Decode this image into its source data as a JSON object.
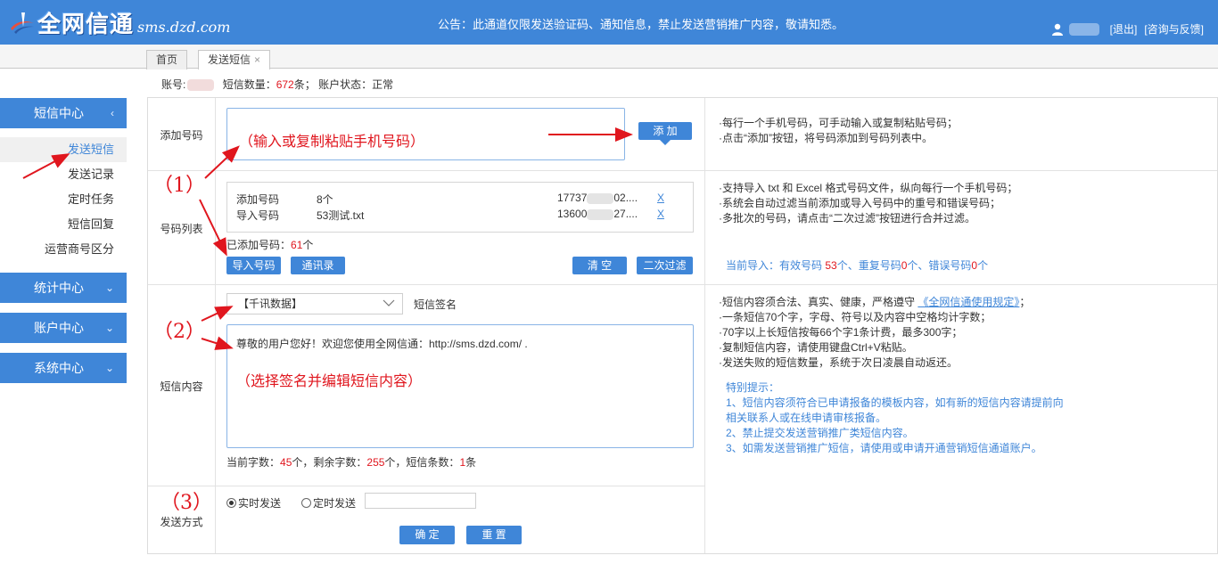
{
  "header": {
    "brand": "全网信通",
    "domain": "sms.dzd.com",
    "notice": "公告：此通道仅限发送验证码、通知信息，禁止发送营销推广内容，敬请知悉。",
    "logout": "[退出]",
    "feedback": "[咨询与反馈]"
  },
  "tabs": [
    {
      "label": "首页"
    },
    {
      "label": "发送短信",
      "close": "×"
    }
  ],
  "account": {
    "account_label": "账号:",
    "sms_count_label": "短信数量：",
    "sms_count": "672",
    "sms_count_unit": "条；",
    "status_label": "账户状态：",
    "status": "正常"
  },
  "sidebar": {
    "sms_center": "短信中心",
    "sms_items": [
      "发送短信",
      "发送记录",
      "定时任务",
      "短信回复",
      "运营商号区分"
    ],
    "stats_center": "统计中心",
    "account_center": "账户中心",
    "system_center": "系统中心",
    "collapse_glyph": "‹",
    "expand_glyph": "⌄"
  },
  "form": {
    "add_number": {
      "label": "添加号码",
      "hint": "（输入或复制粘贴手机号码）",
      "button": "添 加",
      "tips": [
        "·每行一个手机号码，可手动输入或复制粘贴号码；",
        "·点击“添加”按钮，将号码添加到号码列表中。"
      ]
    },
    "number_list": {
      "label": "号码列表",
      "rows": [
        {
          "type": "添加号码",
          "count": "8个",
          "preview_start": "17737",
          "preview_end": "02....",
          "delete": "X"
        },
        {
          "type": "导入号码",
          "count": "53测试.txt",
          "preview_start": "13600",
          "preview_end": "27....",
          "delete": "X"
        }
      ],
      "added_label": "已添加号码：",
      "added_count": "61",
      "added_unit": "个",
      "buttons": {
        "import": "导入号码",
        "contacts": "通讯录",
        "clear": "清 空",
        "second_filter": "二次过滤"
      },
      "tips": [
        "·支持导入 txt 和 Excel 格式号码文件，纵向每行一个手机号码；",
        "·系统会自动过滤当前添加或导入号码中的重号和错误号码；",
        "·多批次的号码，请点击“二次过滤”按钮进行合并过滤。"
      ],
      "import_stat_prefix": "当前导入：有效号码 ",
      "import_valid": "53",
      "import_stat_mid1": "个、重复号码",
      "import_dup": "0",
      "import_stat_mid2": "个、错误号码",
      "import_err": "0",
      "import_stat_suffix": "个"
    },
    "sms_content": {
      "label": "短信内容",
      "sign_selected": "【千讯数据】",
      "sign_label": "短信签名",
      "text": "尊敬的用户您好！欢迎您使用全网信通：http://sms.dzd.com/ .",
      "hint": "（选择签名并编辑短信内容）",
      "count_prefix": "当前字数：",
      "current": "45",
      "count_mid1": "个，剩余字数：",
      "remaining": "255",
      "count_mid2": "个，短信条数：",
      "pieces": "1",
      "count_suffix": "条",
      "tips_pre": "·短信内容须合法、真实、健康，严格遵守 ",
      "tips_link": "《全网信通使用规定》",
      "tips_post": "；",
      "tips": [
        "·一条短信70个字，字母、符号以及内容中空格均计字数；",
        "·70字以上长短信按每66个字1条计费，最多300字；",
        "·复制短信内容，请使用键盘Ctrl+V粘贴。",
        "·发送失败的短信数量，系统于次日凌晨自动返还。"
      ],
      "special_title": "特别提示：",
      "special": [
        "1、短信内容须符合已申请报备的模板内容，如有新的短信内容请提前向",
        "相关联系人或在线申请审核报备。",
        "2、禁止提交发送营销推广类短信内容。",
        "3、如需发送营销推广短信，请使用或申请开通营销短信通道账户。"
      ]
    },
    "send_mode": {
      "label": "发送方式",
      "realtime": "实时发送",
      "scheduled": "定时发送",
      "confirm": "确 定",
      "reset": "重 置"
    },
    "markers": [
      "（1）",
      "（2）",
      "（3）"
    ]
  },
  "colors": {
    "primary": "#3f86d8",
    "highlight": "#e0161e"
  }
}
